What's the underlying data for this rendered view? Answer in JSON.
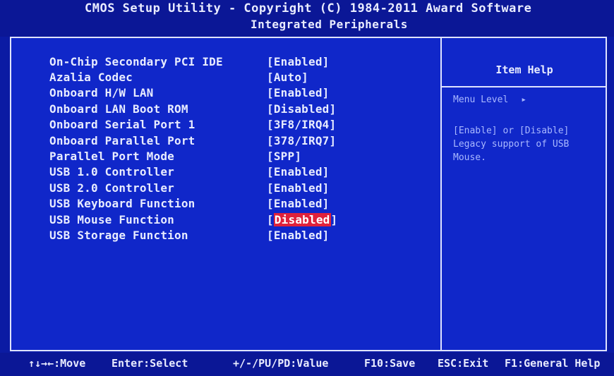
{
  "header": {
    "title": "CMOS Setup Utility - Copyright (C) 1984-2011 Award Software",
    "subtitle": "Integrated Peripherals"
  },
  "settings": [
    {
      "label": "On-Chip Secondary PCI IDE",
      "value": "[Enabled]"
    },
    {
      "label": "Azalia Codec",
      "value": "[Auto]"
    },
    {
      "label": "Onboard H/W LAN",
      "value": "[Enabled]"
    },
    {
      "label": "Onboard LAN Boot ROM",
      "value": "[Disabled]"
    },
    {
      "label": "Onboard Serial Port 1",
      "value": "[3F8/IRQ4]"
    },
    {
      "label": "Onboard Parallel Port",
      "value": "[378/IRQ7]"
    },
    {
      "label": "Parallel Port Mode",
      "value": "[SPP]"
    },
    {
      "label": "USB 1.0 Controller",
      "value": "[Enabled]"
    },
    {
      "label": "USB 2.0 Controller",
      "value": "[Enabled]"
    },
    {
      "label": "USB Keyboard Function",
      "value": "[Enabled]"
    },
    {
      "label": "USB Mouse Function",
      "value_open": "[",
      "value_selected": "Disabled",
      "value_close": "]"
    },
    {
      "label": "USB Storage Function",
      "value": "[Enabled]"
    }
  ],
  "help": {
    "title": "Item Help",
    "menu_level": "Menu Level",
    "menu_level_arrow": "▸",
    "text": "[Enable] or [Disable]\nLegacy support of USB\nMouse."
  },
  "footer": {
    "nav": "↑↓→←:Move",
    "enter": "Enter:Select",
    "value": "+/-/PU/PD:Value",
    "save": "F10:Save",
    "esc": "ESC:Exit",
    "help": "F1:General Help"
  },
  "colors": {
    "background": "#1027c9",
    "highlight": "#e0213b",
    "text": "#e8ecff",
    "help_text": "#a9b8ff"
  }
}
